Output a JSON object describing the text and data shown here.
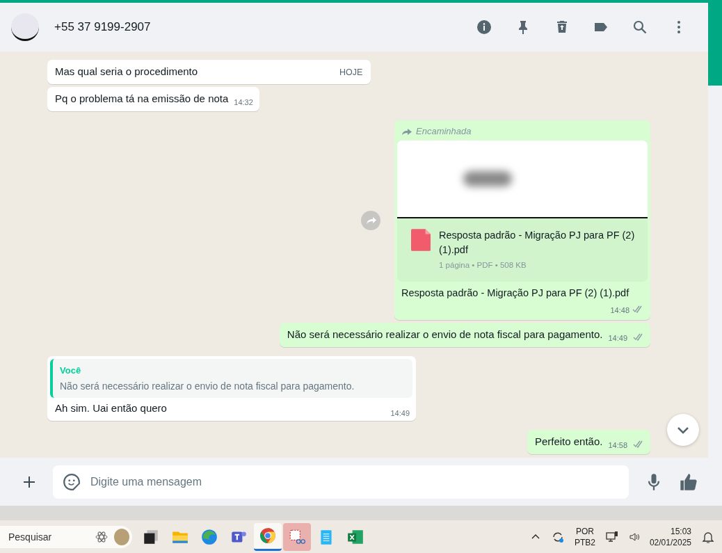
{
  "header": {
    "contact": "+55 37 9199-2907"
  },
  "date_chip": "HOJE",
  "messages": [
    {
      "kind": "text",
      "outgoing": false,
      "text": "Mas qual seria o procedimento"
    },
    {
      "kind": "text",
      "outgoing": false,
      "text": "Pq o problema tá na emissão de nota",
      "time": "14:32"
    },
    {
      "kind": "document",
      "outgoing": true,
      "forwarded": "Encaminhada",
      "title": "Resposta padrão - Migração PJ para PF (2) (1).pdf",
      "meta": "1 página • PDF • 508 KB",
      "caption": "Resposta padrão - Migração PJ para PF (2) (1).pdf",
      "time": "14:48",
      "read": false
    },
    {
      "kind": "text",
      "outgoing": true,
      "text": "Não será necessário realizar o envio de nota fiscal para pagamento.",
      "time": "14:49",
      "read": false
    },
    {
      "kind": "reply",
      "outgoing": false,
      "quote_author": "Você",
      "quote_text": "Não será necessário realizar o envio de nota fiscal para pagamento.",
      "text": "Ah sim. Uai então quero",
      "time": "14:49"
    },
    {
      "kind": "text",
      "outgoing": true,
      "text": "Perfeito então.",
      "time": "14:58",
      "read": false
    }
  ],
  "composer": {
    "placeholder": "Digite uma mensagem"
  },
  "taskbar": {
    "search_placeholder": "Pesquisar",
    "language": "POR",
    "layout": "PTB2",
    "time": "15:03",
    "date": "02/01/2025"
  }
}
